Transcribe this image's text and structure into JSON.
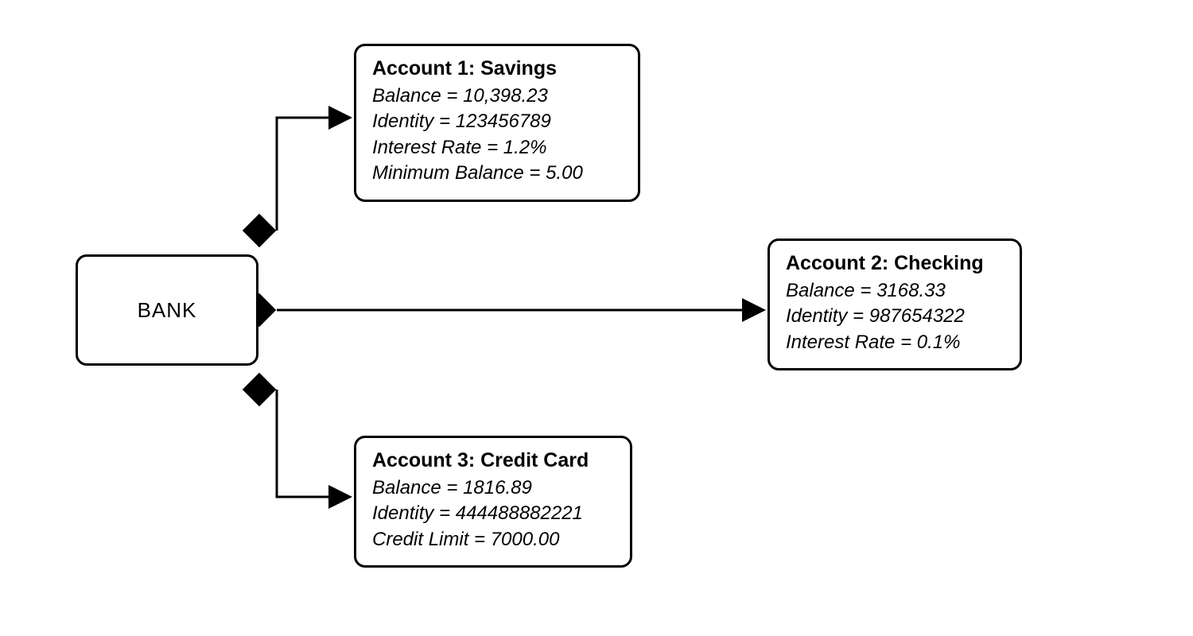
{
  "bank": {
    "label": "BANK"
  },
  "accounts": [
    {
      "title": "Account 1: Savings",
      "attrs": [
        "Balance = 10,398.23",
        "Identity = 123456789",
        "Interest Rate = 1.2%",
        "Minimum Balance = 5.00"
      ]
    },
    {
      "title": "Account 2: Checking",
      "attrs": [
        "Balance = 3168.33",
        "Identity = 987654322",
        "Interest Rate = 0.1%"
      ]
    },
    {
      "title": "Account 3: Credit Card",
      "attrs": [
        "Balance = 1816.89",
        "Identity = 444488882221",
        "Credit Limit = 7000.00"
      ]
    }
  ]
}
